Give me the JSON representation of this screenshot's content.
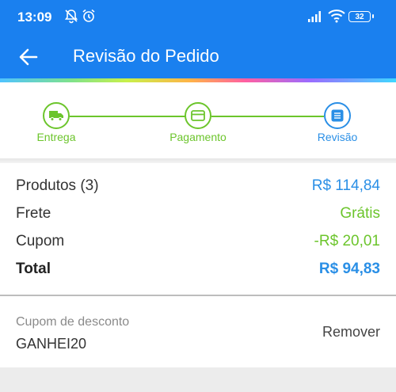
{
  "status_bar": {
    "time": "13:09",
    "battery": "32"
  },
  "app_bar": {
    "title": "Revisão do Pedido"
  },
  "colors": {
    "primary": "#1a80ef",
    "green": "#6cc52c",
    "price_blue": "#2a8fe6"
  },
  "steps": [
    {
      "label": "Entrega",
      "icon": "truck-icon",
      "state": "done"
    },
    {
      "label": "Pagamento",
      "icon": "card-icon",
      "state": "done"
    },
    {
      "label": "Revisão",
      "icon": "list-icon",
      "state": "current"
    }
  ],
  "summary": {
    "products": {
      "label": "Produtos (3)",
      "value": "R$ 114,84"
    },
    "shipping": {
      "label": "Frete",
      "value": "Grátis"
    },
    "coupon": {
      "label": "Cupom",
      "value": "-R$ 20,01"
    },
    "total": {
      "label": "Total",
      "value": "R$ 94,83"
    }
  },
  "discount": {
    "label": "Cupom de desconto",
    "code": "GANHEI20",
    "remove_label": "Remover"
  }
}
